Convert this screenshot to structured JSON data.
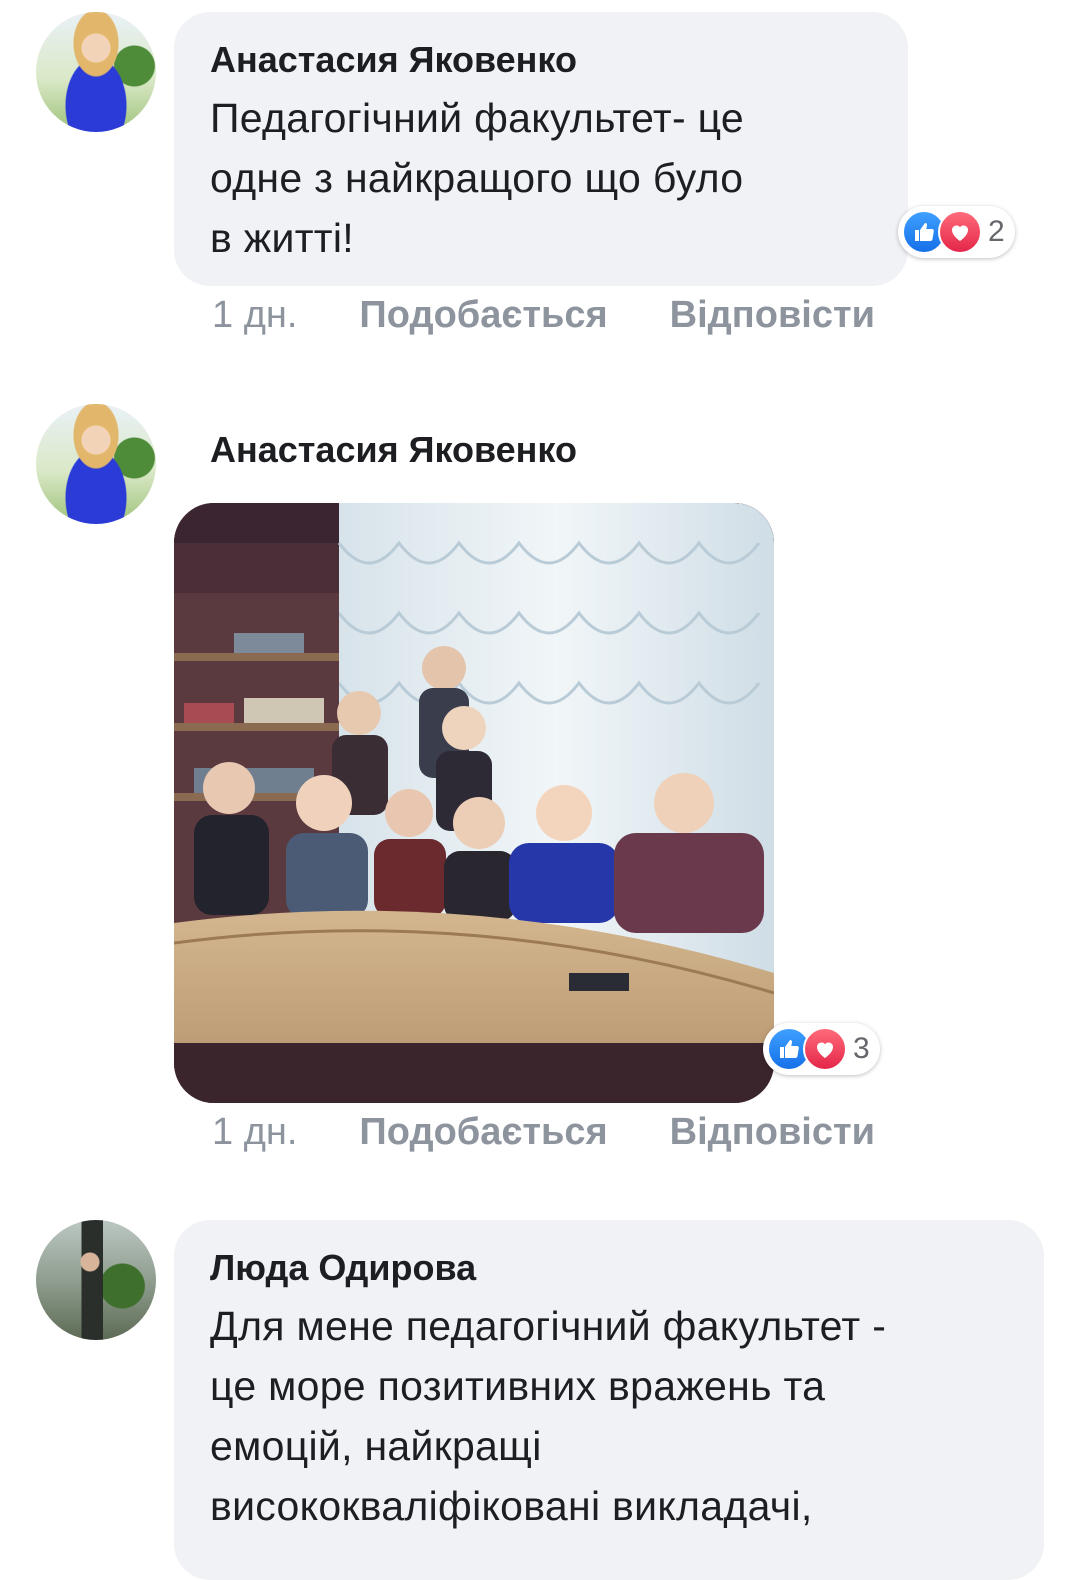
{
  "comments": [
    {
      "author": "Анастасия Яковенко",
      "text_lines": [
        "Педагогічний факультет- це",
        "одне з найкращого що було",
        "в житті!"
      ],
      "reactions_count": "2",
      "time": "1 дн.",
      "like_label": "Подобається",
      "reply_label": "Відповісти"
    },
    {
      "author": "Анастасия Яковенко",
      "reactions_count": "3",
      "time": "1 дн.",
      "like_label": "Подобається",
      "reply_label": "Відповісти"
    },
    {
      "author": "Люда Одирова",
      "text_lines": [
        "Для мене педагогічний факультет -",
        "це море позитивних вражень та",
        "емоцій, найкращі",
        "висококваліфіковані викладачі,"
      ]
    }
  ],
  "icons": {
    "like": "thumbs-up-icon",
    "love": "heart-icon"
  },
  "colors": {
    "bubble": "#f0f2f5",
    "meta_text": "#8d949e",
    "like_blue": "#1877f2",
    "love_red": "#e4264a"
  }
}
